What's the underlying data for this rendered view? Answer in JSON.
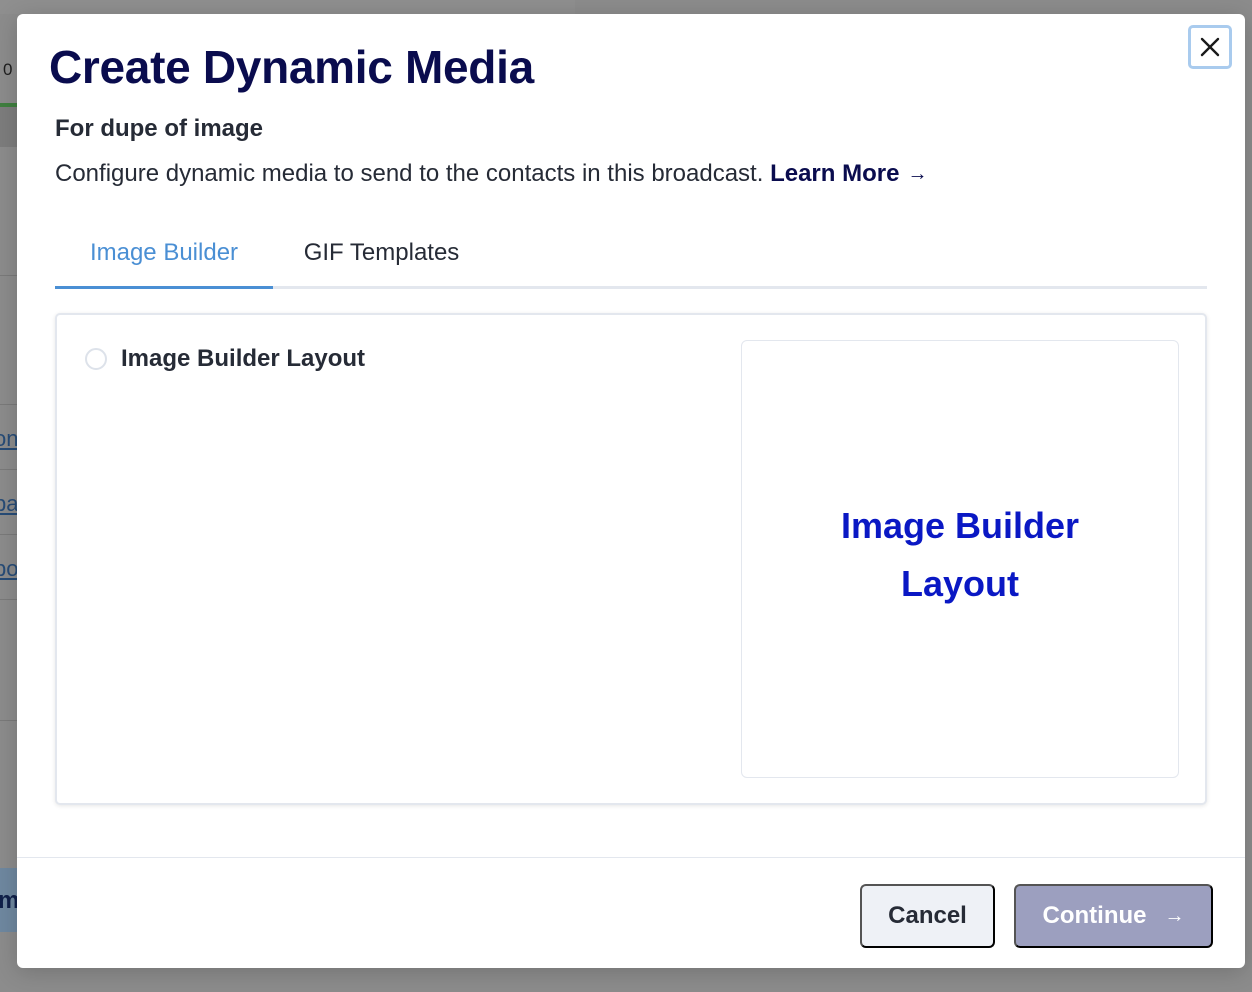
{
  "background": {
    "fragment_number": "0",
    "fragment_letter": "m",
    "link_fragments": [
      "on",
      "pa",
      "po"
    ]
  },
  "modal": {
    "title": "Create Dynamic Media",
    "subtitle": "For dupe of image",
    "description": "Configure dynamic media to send to the contacts in this broadcast.",
    "learn_more": "Learn More",
    "learn_more_icon": "arrow-right-icon",
    "close_icon": "close-icon",
    "tabs": [
      {
        "label": "Image Builder",
        "active": true
      },
      {
        "label": "GIF Templates",
        "active": false
      }
    ],
    "option": {
      "label": "Image Builder Layout",
      "selected": false
    },
    "preview": {
      "text": "Image Builder Layout"
    },
    "footer": {
      "cancel_label": "Cancel",
      "continue_label": "Continue",
      "continue_icon": "arrow-right-icon",
      "continue_disabled": true
    }
  },
  "colors": {
    "title": "#0a0c4e",
    "tab_active": "#4a8fd4",
    "preview_text": "#0a18c4",
    "continue_bg": "#9c9fbf",
    "cancel_bg": "#eef1f6"
  }
}
